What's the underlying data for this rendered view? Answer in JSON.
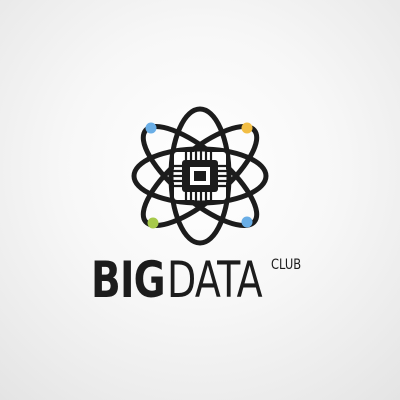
{
  "logo": {
    "word_big": "BIG",
    "word_data": "DATA",
    "word_club": "CLUB",
    "icon": "atom-with-microchip-icon"
  },
  "colors": {
    "background": "#f2f2f2",
    "ink": "#1c1c1c",
    "electron_blue": "#6aaee6",
    "electron_yellow": "#f2be45",
    "electron_green": "#a6c94a"
  }
}
